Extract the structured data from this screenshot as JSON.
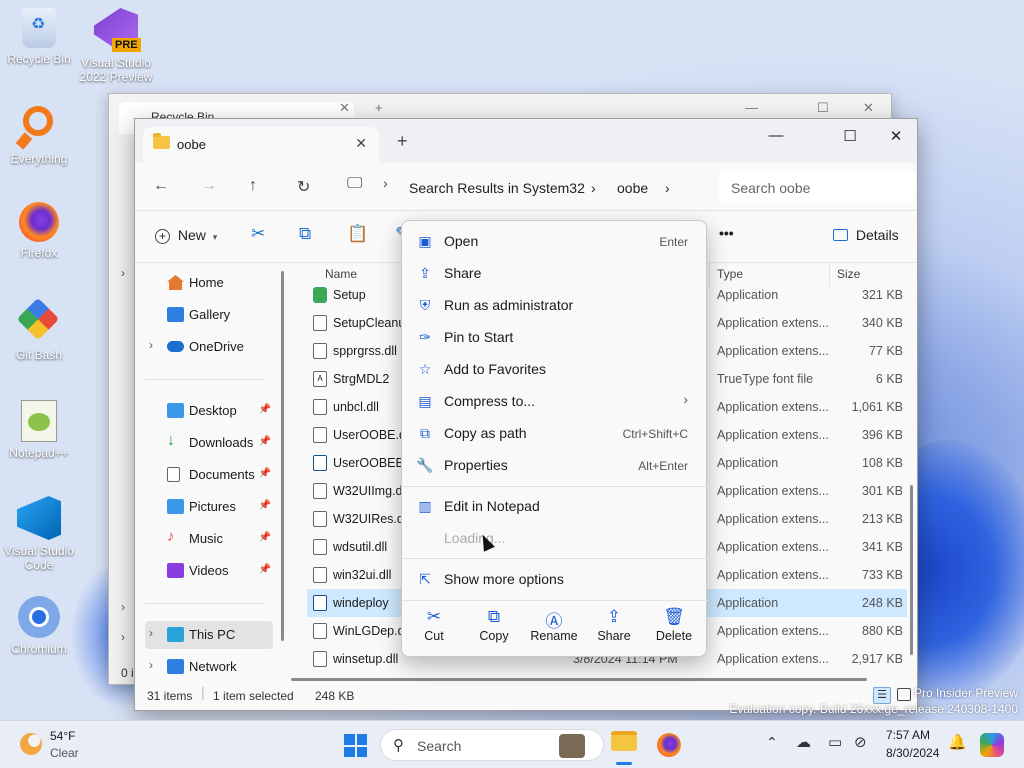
{
  "desktop": {
    "icons": [
      {
        "label": "Recycle Bin",
        "icon": "recycle-bin-icon"
      },
      {
        "label": "Visual Studio 2022 Preview",
        "icon": "visual-studio-icon",
        "badge": "PRE"
      },
      {
        "label": "Everything",
        "icon": "everything-search-icon"
      },
      {
        "label": "Firefox",
        "icon": "firefox-icon"
      },
      {
        "label": "Git Bash",
        "icon": "git-bash-icon"
      },
      {
        "label": "Notepad++",
        "icon": "notepad-plus-plus-icon"
      },
      {
        "label": "Visual Studio Code",
        "icon": "vscode-icon"
      },
      {
        "label": "Chromium",
        "icon": "chromium-icon"
      }
    ],
    "watermark_line1": "Pro Insider Preview",
    "watermark_line2": "Evaluation copy. Build 26xxx.ge_release.240308-1400"
  },
  "back_window": {
    "tab_title": "Recycle Bin",
    "count_fragment": "0 i"
  },
  "window": {
    "tab_title": "oobe",
    "new_tab": "+",
    "close_tab": "✕",
    "minimize": "—",
    "maximize": "☐",
    "close": "✕",
    "breadcrumbs": [
      "Search Results in System32",
      "oobe"
    ],
    "search_placeholder": "Search oobe",
    "toolbar": {
      "new_label": "New",
      "more": "•••",
      "details_label": "Details"
    },
    "nav_pane": {
      "items": [
        {
          "label": "Home",
          "icon": "home-icon"
        },
        {
          "label": "Gallery",
          "icon": "gallery-icon"
        },
        {
          "label": "OneDrive",
          "icon": "onedrive-icon"
        },
        {
          "label": "Desktop",
          "icon": "desktop-folder-icon",
          "pinned": true
        },
        {
          "label": "Downloads",
          "icon": "downloads-folder-icon",
          "pinned": true
        },
        {
          "label": "Documents",
          "icon": "documents-folder-icon",
          "pinned": true
        },
        {
          "label": "Pictures",
          "icon": "pictures-folder-icon",
          "pinned": true
        },
        {
          "label": "Music",
          "icon": "music-folder-icon",
          "pinned": true
        },
        {
          "label": "Videos",
          "icon": "videos-folder-icon",
          "pinned": true
        },
        {
          "label": "This PC",
          "icon": "this-pc-icon",
          "selected": true
        },
        {
          "label": "Network",
          "icon": "network-icon"
        }
      ]
    },
    "columns": {
      "name": "Name",
      "type": "Type",
      "size": "Size"
    },
    "files": [
      {
        "name": "Setup",
        "type": "Application",
        "size": "321 KB"
      },
      {
        "name": "SetupCleanu",
        "type": "Application extens...",
        "size": "340 KB"
      },
      {
        "name": "spprgrss.dll",
        "type": "Application extens...",
        "size": "77 KB"
      },
      {
        "name": "StrgMDL2",
        "type": "TrueType font file",
        "size": "6 KB"
      },
      {
        "name": "unbcl.dll",
        "type": "Application extens...",
        "size": "1,061 KB"
      },
      {
        "name": "UserOOBE.dll",
        "type": "Application extens...",
        "size": "396 KB"
      },
      {
        "name": "UserOOBEBro",
        "type": "Application",
        "size": "108 KB"
      },
      {
        "name": "W32UIImg.dll",
        "type": "Application extens...",
        "size": "301 KB"
      },
      {
        "name": "W32UIRes.dll",
        "type": "Application extens...",
        "size": "213 KB"
      },
      {
        "name": "wdsutil.dll",
        "type": "Application extens...",
        "size": "341 KB"
      },
      {
        "name": "win32ui.dll",
        "type": "Application extens...",
        "size": "733 KB"
      },
      {
        "name": "windeploy",
        "type": "Application",
        "size": "248 KB",
        "selected": true
      },
      {
        "name": "WinLGDep.dll",
        "type": "Application extens...",
        "size": "880 KB"
      },
      {
        "name": "winsetup.dll",
        "type": "Application extens...",
        "size": "2,917 KB",
        "date": "3/8/2024 11:14 PM"
      }
    ],
    "status": {
      "items": "31 items",
      "selected": "1 item selected",
      "size": "248 KB"
    }
  },
  "context_menu": {
    "items": [
      {
        "label": "Open",
        "shortcut": "Enter",
        "icon": "open-icon"
      },
      {
        "label": "Share",
        "shortcut": "",
        "icon": "share-icon"
      },
      {
        "label": "Run as administrator",
        "shortcut": "",
        "icon": "shield-icon"
      },
      {
        "label": "Pin to Start",
        "shortcut": "",
        "icon": "pin-icon"
      },
      {
        "label": "Add to Favorites",
        "shortcut": "",
        "icon": "star-icon"
      },
      {
        "label": "Compress to...",
        "shortcut": "›",
        "icon": "zip-icon"
      },
      {
        "label": "Copy as path",
        "shortcut": "Ctrl+Shift+C",
        "icon": "copy-path-icon"
      },
      {
        "label": "Properties",
        "shortcut": "Alt+Enter",
        "icon": "properties-icon"
      },
      {
        "label": "Edit in Notepad",
        "shortcut": "",
        "icon": "notepad-icon"
      },
      {
        "label": "Loading...",
        "shortcut": "",
        "icon": ""
      },
      {
        "label": "Show more options",
        "shortcut": "",
        "icon": "more-options-icon"
      }
    ],
    "quick_actions": [
      {
        "label": "Cut",
        "icon": "cut-icon"
      },
      {
        "label": "Copy",
        "icon": "copy-icon"
      },
      {
        "label": "Rename",
        "icon": "rename-icon"
      },
      {
        "label": "Share",
        "icon": "share-icon"
      },
      {
        "label": "Delete",
        "icon": "delete-icon"
      }
    ]
  },
  "taskbar": {
    "weather_temp": "54°F",
    "weather_cond": "Clear",
    "search_label": "Search",
    "time": "7:57 AM",
    "date": "8/30/2024"
  }
}
